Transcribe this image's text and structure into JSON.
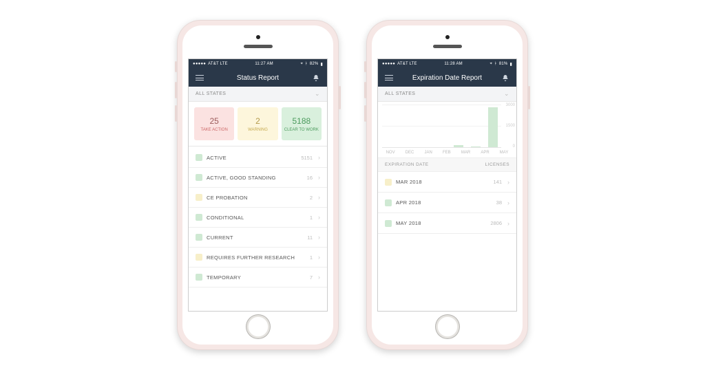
{
  "phone1": {
    "status_bar": {
      "carrier": "AT&T  LTE",
      "time": "11:27 AM",
      "battery": "82%"
    },
    "nav_title": "Status Report",
    "filter_label": "ALL STATES",
    "cards": {
      "take_action": {
        "count": "25",
        "label": "TAKE ACTION"
      },
      "warning": {
        "count": "2",
        "label": "WARNING"
      },
      "clear": {
        "count": "5188",
        "label": "CLEAR TO WORK"
      }
    },
    "rows": [
      {
        "swatch": "grn",
        "label": "ACTIVE",
        "count": "5151"
      },
      {
        "swatch": "grn",
        "label": "ACTIVE, GOOD STANDING",
        "count": "16"
      },
      {
        "swatch": "yel",
        "label": "CE PROBATION",
        "count": "2"
      },
      {
        "swatch": "grn",
        "label": "CONDITIONAL",
        "count": "1"
      },
      {
        "swatch": "grn",
        "label": "CURRENT",
        "count": "11"
      },
      {
        "swatch": "yel",
        "label": "REQUIRES FURTHER RESEARCH",
        "count": "1"
      },
      {
        "swatch": "grn",
        "label": "TEMPORARY",
        "count": "7"
      }
    ]
  },
  "phone2": {
    "status_bar": {
      "carrier": "AT&T  LTE",
      "time": "11:28 AM",
      "battery": "81%"
    },
    "nav_title": "Expiration Date Report",
    "filter_label": "ALL STATES",
    "chart": {
      "ymax": 3000,
      "ymid": 1500,
      "ymin": 0,
      "xticks": [
        "NOV",
        "DEC",
        "JAN",
        "FEB",
        "MAR",
        "APR",
        "MAY"
      ],
      "data": {
        "NOV": 0,
        "DEC": 0,
        "JAN": 0,
        "FEB": 0,
        "MAR": 141,
        "APR": 38,
        "MAY": 2806
      }
    },
    "table_head": {
      "a": "EXPIRATION DATE",
      "b": "LICENSES"
    },
    "rows": [
      {
        "swatch": "yel",
        "label": "MAR 2018",
        "count": "141"
      },
      {
        "swatch": "grn",
        "label": "APR 2018",
        "count": "38"
      },
      {
        "swatch": "grn",
        "label": "MAY 2018",
        "count": "2806"
      }
    ]
  },
  "chart_data": {
    "type": "bar",
    "title": "Expiration Date Report",
    "categories": [
      "NOV",
      "DEC",
      "JAN",
      "FEB",
      "MAR",
      "APR",
      "MAY"
    ],
    "values": [
      0,
      0,
      0,
      0,
      141,
      38,
      2806
    ],
    "xlabel": "",
    "ylabel": "",
    "ylim": [
      0,
      3000
    ]
  }
}
